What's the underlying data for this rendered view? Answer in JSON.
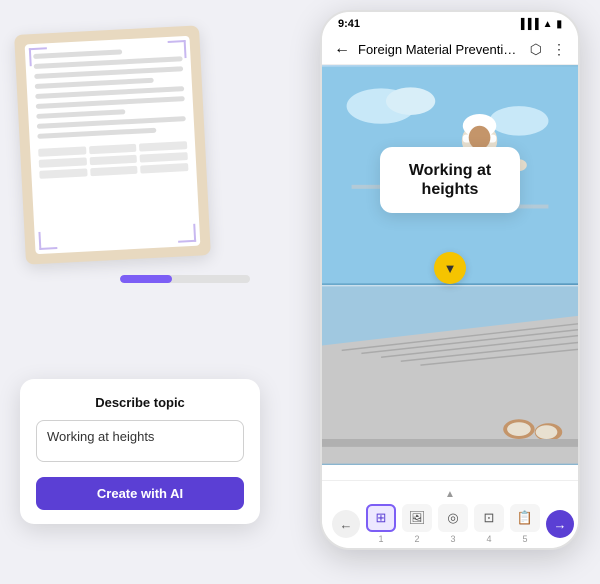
{
  "phone": {
    "status_time": "9:41",
    "nav_title": "Foreign Material Prevention...",
    "card_title_line1": "Working at",
    "card_title_line2": "heights"
  },
  "toolbar": {
    "items": [
      {
        "label": "1",
        "icon": "□"
      },
      {
        "label": "2",
        "icon": "🖼"
      },
      {
        "label": "3",
        "icon": "✓"
      },
      {
        "label": "4",
        "icon": "🖼"
      },
      {
        "label": "5",
        "icon": "📄"
      }
    ]
  },
  "describe_card": {
    "title": "Describe topic",
    "input_value": "Working at heights",
    "button_label": "Create with AI"
  }
}
